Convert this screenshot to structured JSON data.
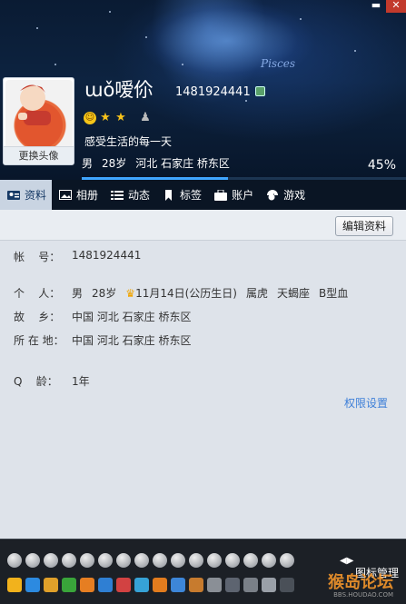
{
  "window": {
    "close_icon": "close-icon",
    "min_icon": "minimize-icon"
  },
  "header": {
    "nickname": "ɯǒ嗳伱",
    "qq_number": "1481924441",
    "level_icons": [
      "sun-icon",
      "star-icon",
      "star-icon",
      "level-badge-icon"
    ],
    "signature": "感受生活的每一天",
    "gender": "男",
    "age": "28岁",
    "location": "河北 石家庄 桥东区",
    "percent": "45%",
    "percent_value": 0.45,
    "background_text": "Pisces",
    "change_avatar": "更换头像"
  },
  "tabs": [
    {
      "label": "资料",
      "icon": "profile-card-icon",
      "active": true
    },
    {
      "label": "相册",
      "icon": "album-icon"
    },
    {
      "label": "动态",
      "icon": "list-icon"
    },
    {
      "label": "标签",
      "icon": "bookmark-icon"
    },
    {
      "label": "账户",
      "icon": "wallet-icon"
    },
    {
      "label": "游戏",
      "icon": "game-icon"
    }
  ],
  "profile": {
    "edit_button": "编辑资料",
    "account_label": "帐    号：",
    "account_value": "1481924441",
    "personal_label": "个    人：",
    "personal": {
      "gender": "男",
      "age": "28岁",
      "birthday": "11月14日(公历生日)",
      "zodiac": "属虎",
      "constellation": "天蝎座",
      "blood": "B型血"
    },
    "hometown_label": "故    乡：",
    "hometown": "中国 河北 石家庄 桥东区",
    "location_label": "所 在 地：",
    "location": "中国 河北 石家庄 桥东区",
    "qage_label": "Q    龄：",
    "qage": "1年",
    "permission_link": "权限设置"
  },
  "footer": {
    "manage": "图标管理",
    "watermark": "猴岛论坛",
    "watermark_url": "BBS.HOUDAO.COM"
  },
  "colors": {
    "accent": "#3fa5ff",
    "tab_active_bg": "#c9d4e2",
    "link": "#3d7fd8"
  }
}
